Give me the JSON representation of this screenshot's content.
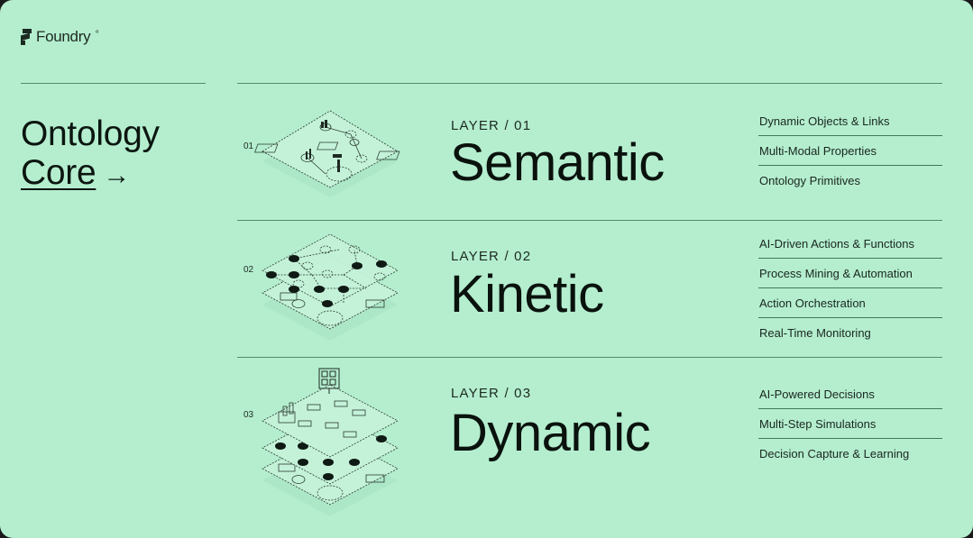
{
  "brand": {
    "name": "Foundry",
    "superscript": "º"
  },
  "left": {
    "title_line1": "Ontology",
    "title_link": "Core",
    "arrow": "→"
  },
  "layers": [
    {
      "index": "01",
      "label": "LAYER / 01",
      "name": "Semantic",
      "illustration": "semantic-layer-illustration",
      "features": [
        "Dynamic Objects & Links",
        "Multi-Modal Properties",
        "Ontology Primitives"
      ]
    },
    {
      "index": "02",
      "label": "LAYER / 02",
      "name": "Kinetic",
      "illustration": "kinetic-layer-illustration",
      "features": [
        "AI-Driven Actions & Functions",
        "Process Mining & Automation",
        "Action Orchestration",
        "Real-Time Monitoring"
      ]
    },
    {
      "index": "03",
      "label": "LAYER / 03",
      "name": "Dynamic",
      "illustration": "dynamic-layer-illustration",
      "features": [
        "AI-Powered Decisions",
        "Multi-Step Simulations",
        "Decision Capture & Learning"
      ]
    }
  ],
  "colors": {
    "background": "#b4eecf",
    "divider": "#4f8d6a",
    "text": "#0a120d"
  }
}
